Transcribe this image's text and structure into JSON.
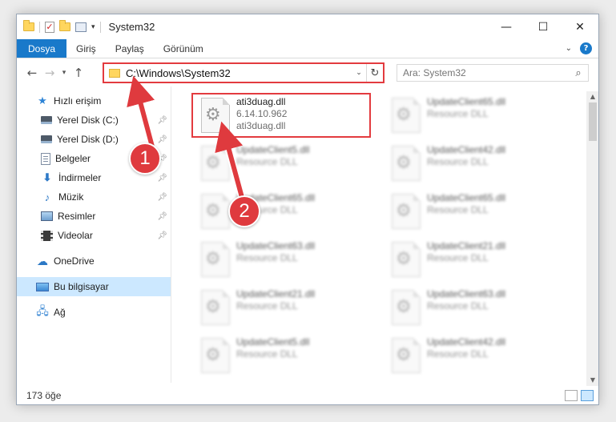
{
  "window": {
    "title": "System32",
    "controls": {
      "minimize": "—",
      "maximize": "☐",
      "close": "✕"
    }
  },
  "ribbon": {
    "tabs": [
      "Dosya",
      "Giriş",
      "Paylaş",
      "Görünüm"
    ],
    "expand_icon": "chevron-down-icon",
    "help_label": "?"
  },
  "navigation": {
    "address_path": "C:\\Windows\\System32",
    "search_placeholder": "Ara: System32"
  },
  "sidebar": {
    "items": [
      {
        "label": "Hızlı erişim",
        "icon": "star-icon",
        "pinned": false
      },
      {
        "label": "Yerel Disk (C:)",
        "icon": "disk-icon",
        "pinned": true
      },
      {
        "label": "Yerel Disk (D:)",
        "icon": "disk-icon",
        "pinned": true
      },
      {
        "label": "Belgeler",
        "icon": "document-icon",
        "pinned": true
      },
      {
        "label": "İndirmeler",
        "icon": "download-icon",
        "pinned": true
      },
      {
        "label": "Müzik",
        "icon": "music-icon",
        "pinned": true
      },
      {
        "label": "Resimler",
        "icon": "pictures-icon",
        "pinned": true
      },
      {
        "label": "Videolar",
        "icon": "video-icon",
        "pinned": true
      },
      {
        "label": "OneDrive",
        "icon": "cloud-icon",
        "pinned": false
      },
      {
        "label": "Bu bilgisayar",
        "icon": "computer-icon",
        "pinned": false,
        "selected": true
      },
      {
        "label": "Ağ",
        "icon": "network-icon",
        "pinned": false
      }
    ]
  },
  "files": {
    "highlighted": {
      "name": "ati3duag.dll",
      "version": "6.14.10.962",
      "description": "ati3duag.dll"
    },
    "blurred": [
      {
        "name": "UpdateClient65.dll",
        "description": "Resource DLL"
      },
      {
        "name": "UpdateClient5.dll",
        "description": "Resource DLL"
      },
      {
        "name": "UpdateClient42.dll",
        "description": "Resource DLL"
      },
      {
        "name": "UpdateClient65.dll",
        "description": "Resource DLL"
      },
      {
        "name": "UpdateClient65.dll",
        "description": "Resource DLL"
      },
      {
        "name": "UpdateClient63.dll",
        "description": "Resource DLL"
      },
      {
        "name": "UpdateClient21.dll",
        "description": "Resource DLL"
      },
      {
        "name": "UpdateClient21.dll",
        "description": "Resource DLL"
      },
      {
        "name": "UpdateClient63.dll",
        "description": "Resource DLL"
      },
      {
        "name": "UpdateClient5.dll",
        "description": "Resource DLL"
      },
      {
        "name": "UpdateClient42.dll",
        "description": "Resource DLL"
      }
    ]
  },
  "status": {
    "item_count": "173 öğe"
  },
  "annotations": {
    "callout_1": "1",
    "callout_2": "2",
    "color": "#df3a3e"
  }
}
